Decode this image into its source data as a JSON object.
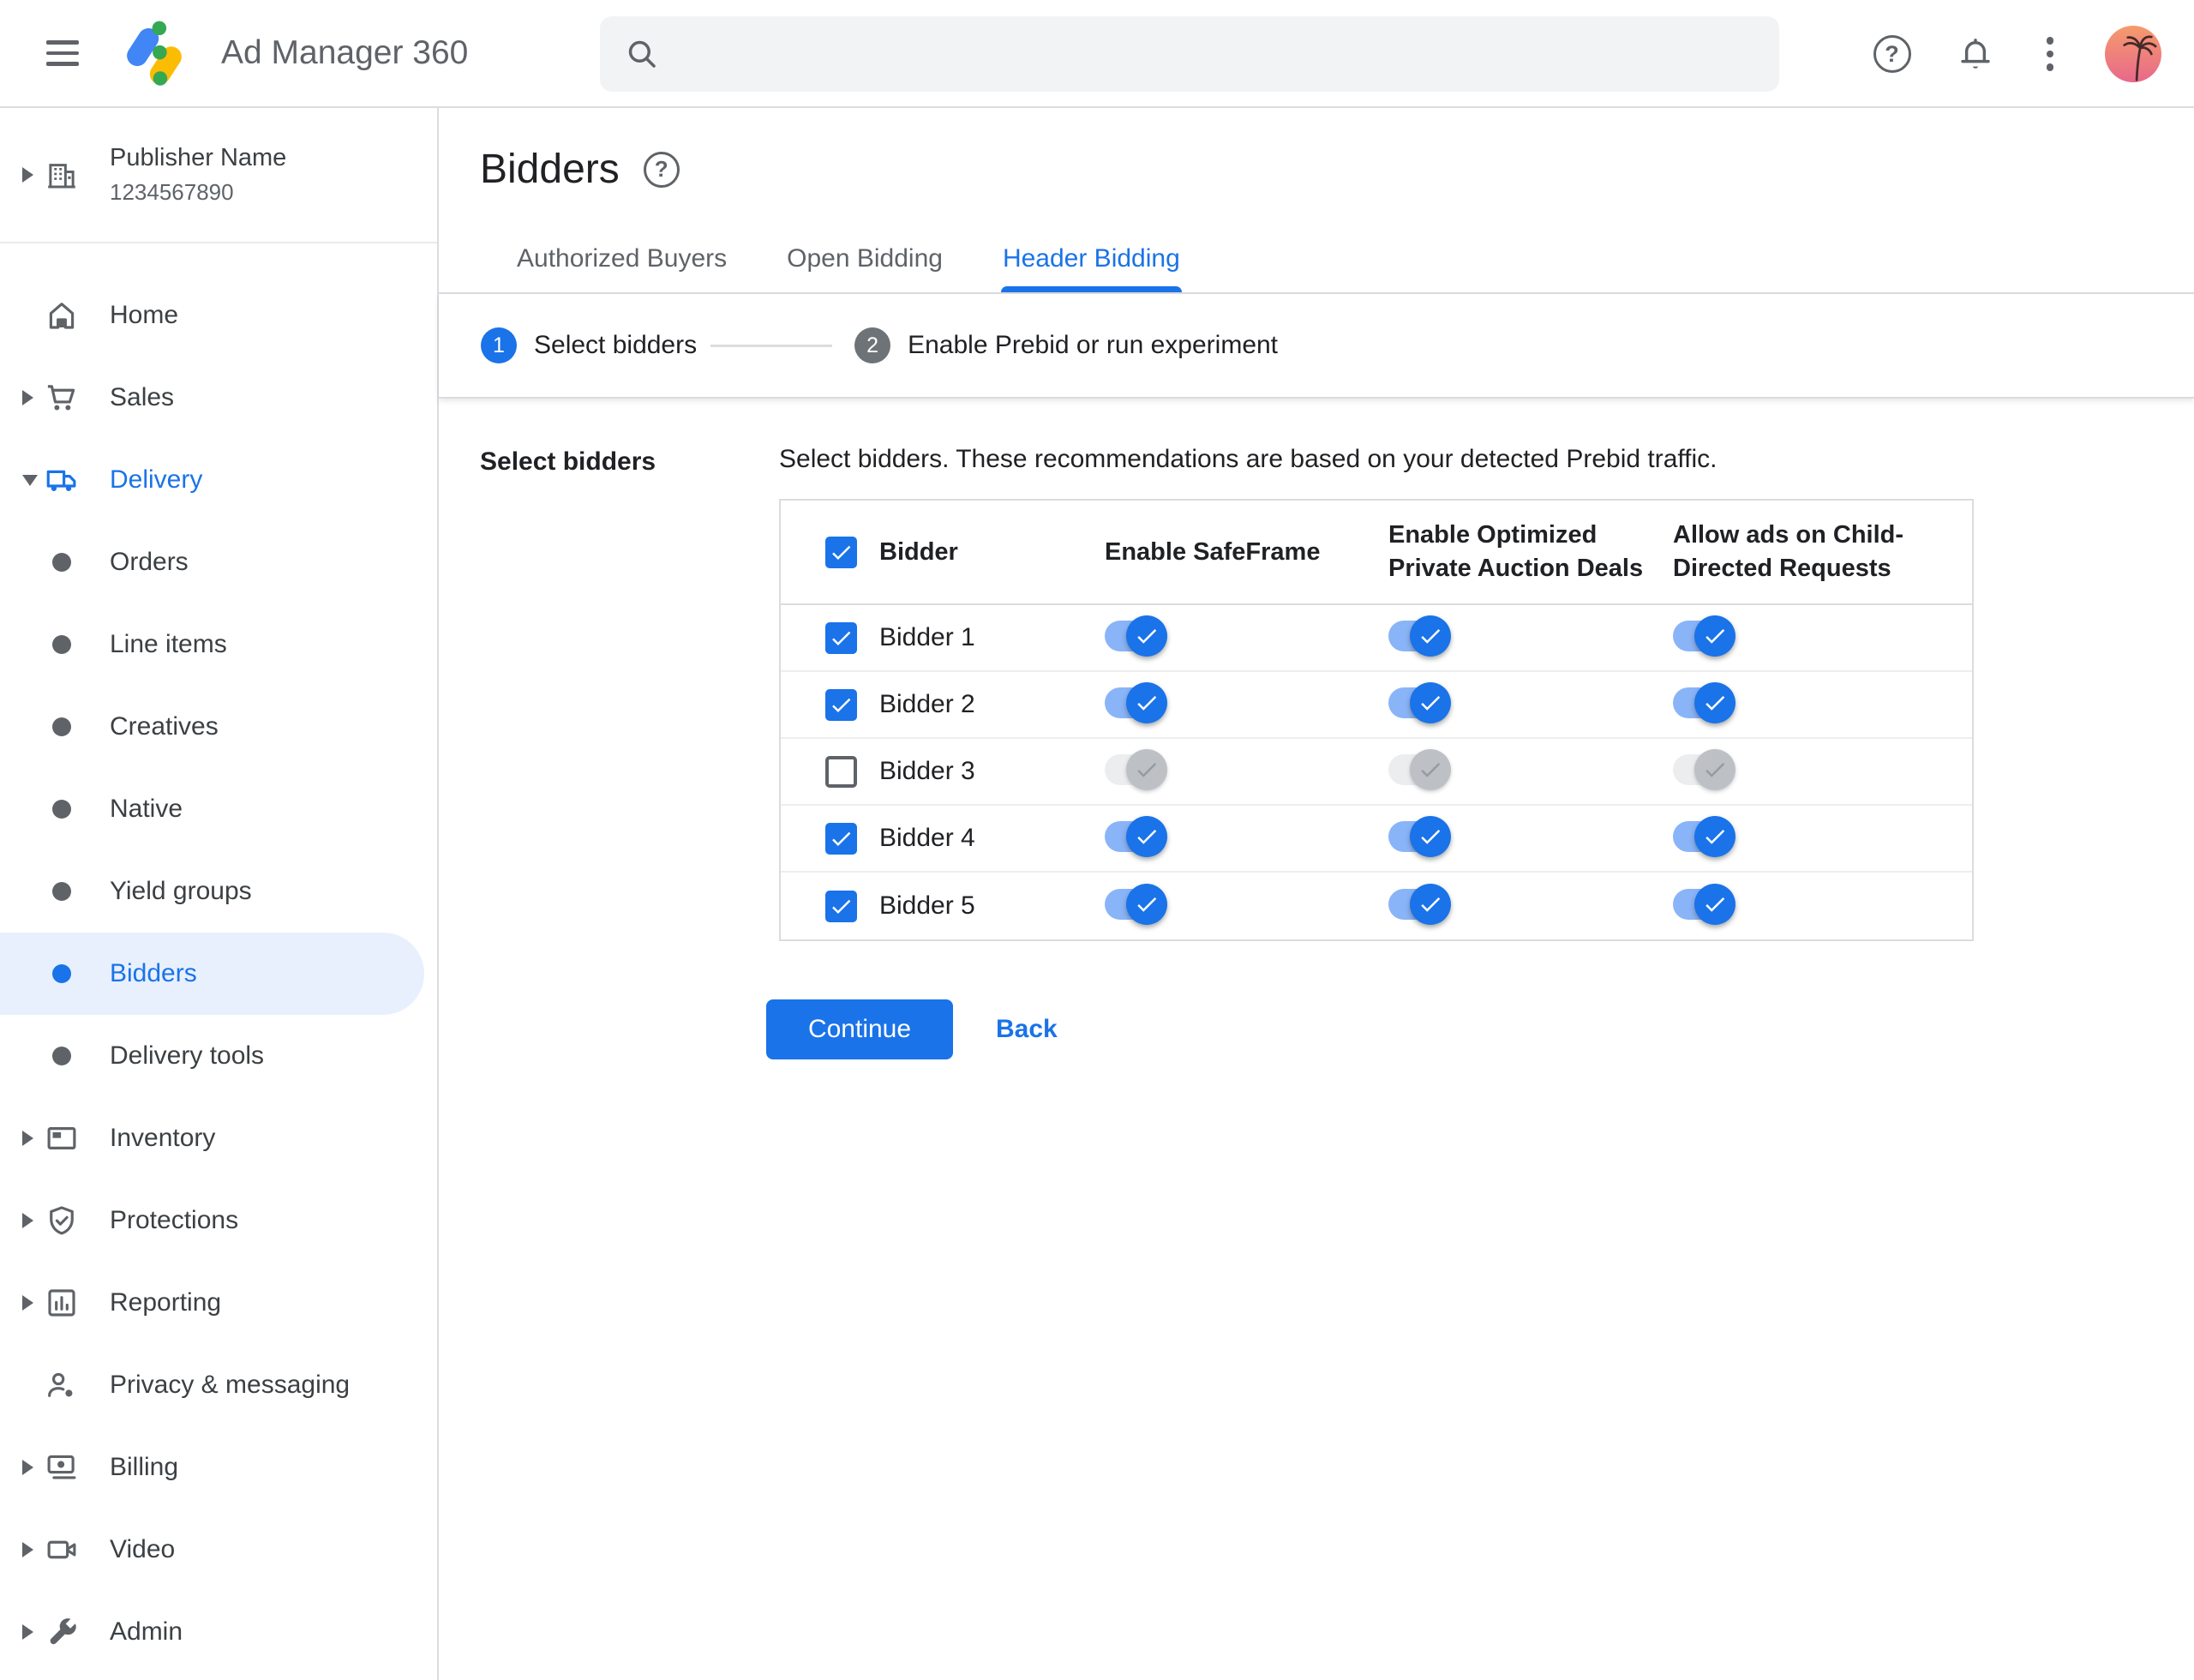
{
  "topbar": {
    "app_title": "Ad Manager 360",
    "search_placeholder": "",
    "help_glyph": "?"
  },
  "sidebar": {
    "publisher": {
      "name": "Publisher Name",
      "id": "1234567890"
    },
    "items": [
      {
        "label": "Home"
      },
      {
        "label": "Sales"
      },
      {
        "label": "Delivery"
      },
      {
        "label": "Orders"
      },
      {
        "label": "Line items"
      },
      {
        "label": "Creatives"
      },
      {
        "label": "Native"
      },
      {
        "label": "Yield groups"
      },
      {
        "label": "Bidders"
      },
      {
        "label": "Delivery tools"
      },
      {
        "label": "Inventory"
      },
      {
        "label": "Protections"
      },
      {
        "label": "Reporting"
      },
      {
        "label": "Privacy & messaging"
      },
      {
        "label": "Billing"
      },
      {
        "label": "Video"
      },
      {
        "label": "Admin"
      }
    ]
  },
  "page": {
    "title": "Bidders"
  },
  "tabs": [
    {
      "label": "Authorized Buyers",
      "active": false
    },
    {
      "label": "Open Bidding",
      "active": false
    },
    {
      "label": "Header Bidding",
      "active": true
    }
  ],
  "stepper": {
    "steps": [
      {
        "number": "1",
        "label": "Select bidders",
        "active": true
      },
      {
        "number": "2",
        "label": "Enable Prebid or run experiment",
        "active": false
      }
    ]
  },
  "section": {
    "heading": "Select bidders",
    "description": "Select bidders. These recommendations are based on your detected Prebid traffic."
  },
  "table": {
    "header_checkbox_checked": true,
    "headers": {
      "bidder": "Bidder",
      "safeframe": "Enable SafeFrame",
      "optimized": "Enable Optimized\nPrivate Auction Deals",
      "child_directed": "Allow ads on Child-\nDirected Requests"
    },
    "rows": [
      {
        "name": "Bidder 1",
        "checked": true,
        "safeframe": true,
        "optimized": true,
        "child_directed": true
      },
      {
        "name": "Bidder 2",
        "checked": true,
        "safeframe": true,
        "optimized": true,
        "child_directed": true
      },
      {
        "name": "Bidder 3",
        "checked": false,
        "safeframe": false,
        "optimized": false,
        "child_directed": false
      },
      {
        "name": "Bidder 4",
        "checked": true,
        "safeframe": true,
        "optimized": true,
        "child_directed": true
      },
      {
        "name": "Bidder 5",
        "checked": true,
        "safeframe": true,
        "optimized": true,
        "child_directed": true
      }
    ]
  },
  "actions": {
    "continue_label": "Continue",
    "back_label": "Back"
  },
  "colors": {
    "accent": "#1A73E8",
    "accent_track": "#8AB4F8",
    "selected_item_bg": "#E8F0FE",
    "text_primary": "#202124",
    "text_secondary": "#5F6368",
    "border": "#DADCE0",
    "search_bg": "#F1F3F4",
    "step_inactive": "#6E7377",
    "disabled_track": "#ECEDEF",
    "disabled_thumb": "#BDC1C6"
  }
}
